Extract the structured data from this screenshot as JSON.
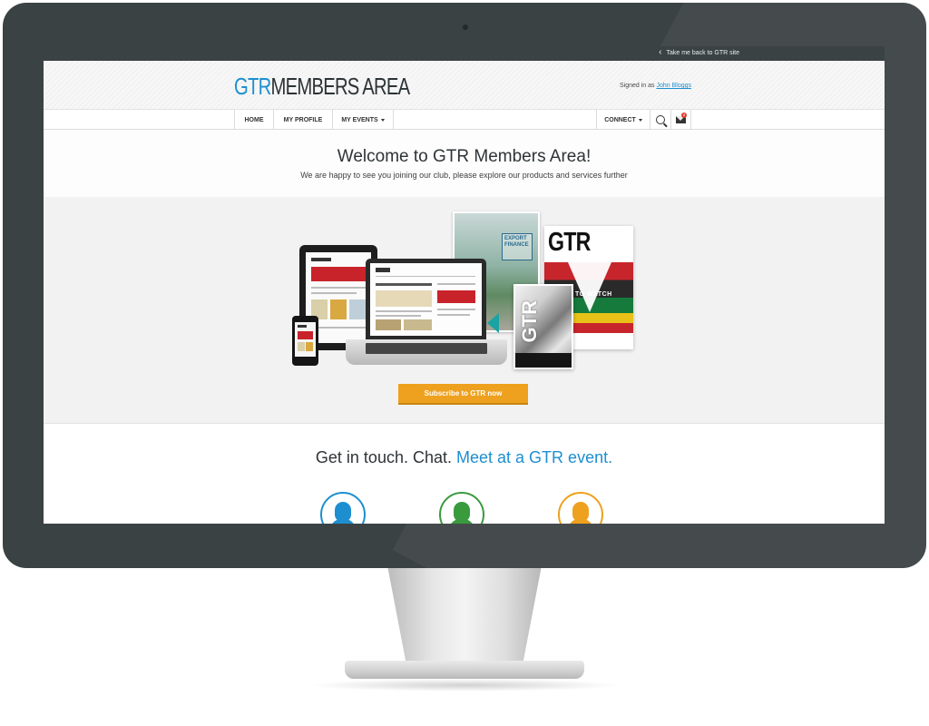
{
  "topbar": {
    "back_link": "Take me back to GTR site"
  },
  "header": {
    "logo_gtr": "GTR",
    "logo_rest": "MEMBERS AREA",
    "signed_in_prefix": "Signed in as",
    "user_name": "John Bloggs"
  },
  "nav": {
    "home": "HOME",
    "profile": "MY PROFILE",
    "events": "MY EVENTS",
    "connect": "CONNECT",
    "mail_count": "2"
  },
  "welcome": {
    "title": "Welcome to GTR Members Area!",
    "subtitle": "We are happy to see you joining our club, please explore our products and services further"
  },
  "showcase": {
    "subscribe_label": "Subscribe to GTR now",
    "mag_box_text": "EXPORT FINANCE",
    "mag_cover_title": "GTR",
    "mag_watch_text": "TO WATCH"
  },
  "contact": {
    "title_plain": "Get in touch. Chat.",
    "title_highlight": "Meet at a GTR event.",
    "icon_colors": [
      "#1d8fd0",
      "#3a9a3e",
      "#eea11e"
    ]
  }
}
